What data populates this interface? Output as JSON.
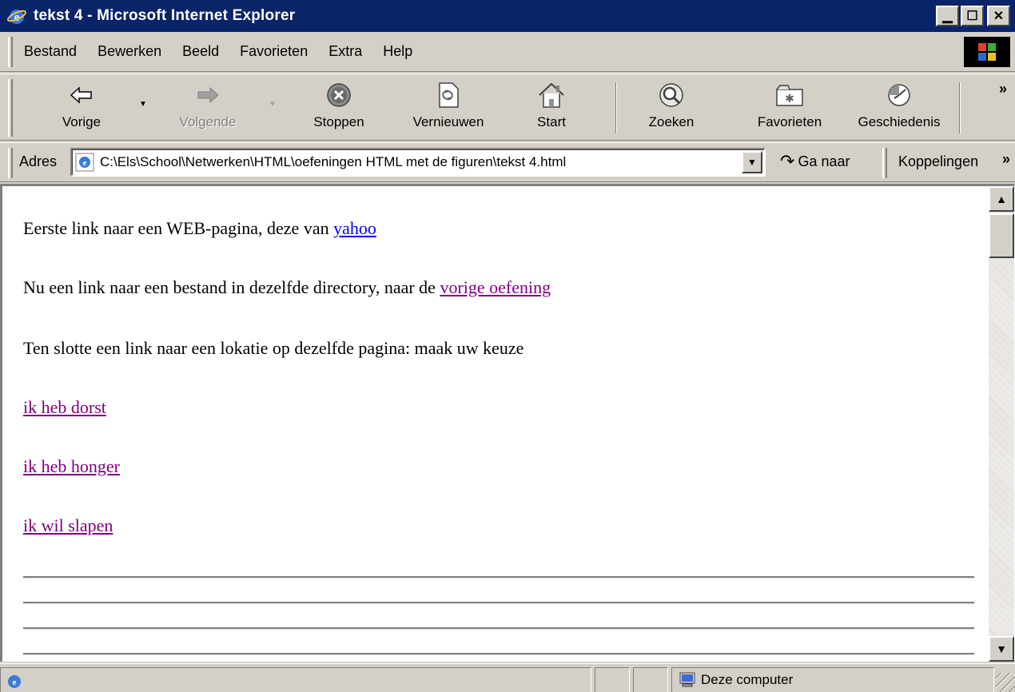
{
  "window": {
    "title": "tekst 4 - Microsoft Internet Explorer",
    "controls": [
      "minimize",
      "maximize",
      "close"
    ]
  },
  "menu": {
    "items": [
      "Bestand",
      "Bewerken",
      "Beeld",
      "Favorieten",
      "Extra",
      "Help"
    ]
  },
  "toolbar": {
    "back": "Vorige",
    "forward": "Volgende",
    "stop": "Stoppen",
    "refresh": "Vernieuwen",
    "home": "Start",
    "search": "Zoeken",
    "favorites": "Favorieten",
    "history": "Geschiedenis"
  },
  "address": {
    "label": "Adres",
    "value": "C:\\Els\\School\\Netwerken\\HTML\\oefeningen HTML met de figuren\\tekst 4.html",
    "go": "Ga naar",
    "links": "Koppelingen"
  },
  "page": {
    "line1_text": "Eerste link naar een WEB-pagina, deze van ",
    "line1_link": "yahoo",
    "line2_text": "Nu een link naar een bestand in dezelfde directory, naar de ",
    "line2_link": "vorige oefening",
    "line3_text": "Ten slotte een link naar een lokatie op dezelfde pagina: maak uw keuze",
    "anchors": [
      "ik heb dorst",
      "ik heb honger",
      "ik wil slapen"
    ]
  },
  "status": {
    "zone": "Deze computer"
  },
  "colors": {
    "titlebar": "#0a246a",
    "link": "#0000ee",
    "visited_link": "#800080",
    "chrome": "#d4d0c8"
  }
}
